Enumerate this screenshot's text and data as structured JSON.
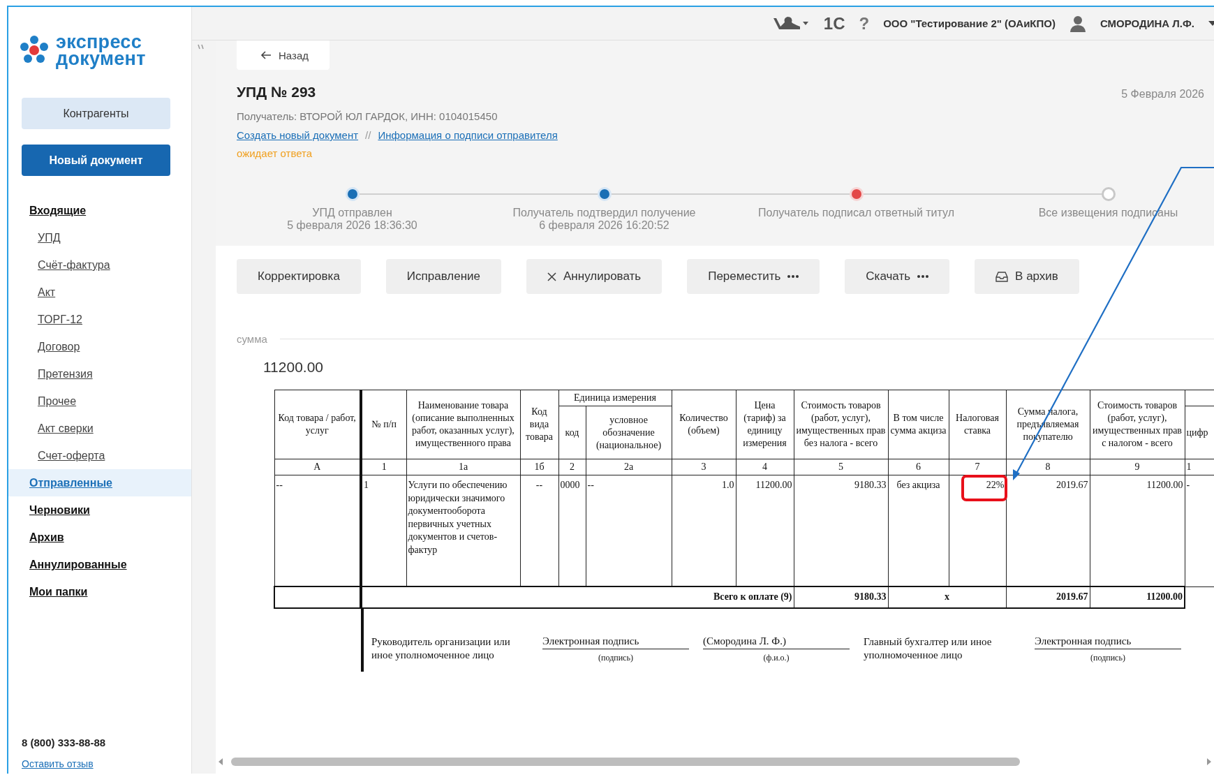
{
  "sidebar": {
    "logo": {
      "line1": "экспресс",
      "line2": "документ"
    },
    "contractors_button": "Контрагенты",
    "new_document_button": "Новый документ",
    "nav": [
      {
        "label": "Входящие",
        "selected": false,
        "children": [
          {
            "label": "УПД",
            "selected": false
          },
          {
            "label": "Счёт-фактура",
            "selected": false
          },
          {
            "label": "Акт",
            "selected": false
          },
          {
            "label": "ТОРГ-12",
            "selected": false
          },
          {
            "label": "Договор",
            "selected": false
          },
          {
            "label": "Претензия",
            "selected": false
          },
          {
            "label": "Прочее",
            "selected": false
          },
          {
            "label": "Акт сверки",
            "selected": false
          },
          {
            "label": "Счет-оферта",
            "selected": false
          }
        ]
      },
      {
        "label": "Отправленные",
        "selected": true
      },
      {
        "label": "Черновики",
        "selected": false
      },
      {
        "label": "Архив",
        "selected": false
      },
      {
        "label": "Аннулированные",
        "selected": false
      },
      {
        "label": "Мои папки",
        "selected": false
      }
    ],
    "phone": "8 (800) 333-88-88",
    "feedback_link": "Оставить отзыв"
  },
  "top_bar": {
    "logo_1c": "1С",
    "help": "?",
    "organization": "ООО \"Тестирование 2\" (ОАиКПО)",
    "user": "СМОРОДИНА Л.Ф."
  },
  "back_button": "Назад",
  "document": {
    "title": "УПД № 293",
    "date": "5 Февраля 2026",
    "recipient": "Получатель: ВТОРОЙ ЮЛ ГАРДОК, ИНН: 0104015450",
    "links": [
      "Создать новый документ",
      "Информация о подписи отправителя"
    ],
    "separator": "//",
    "status": "ожидает ответа"
  },
  "stepper": [
    {
      "label": "УПД отправлен",
      "date": "5 февраля 2026 18:36:30",
      "kind": "done"
    },
    {
      "label": "Получатель подтвердил получение",
      "date": "6 февраля 2026 16:20:52",
      "kind": "done"
    },
    {
      "label": "Получатель подписал ответный титул",
      "kind": "error"
    },
    {
      "label": "Все извещения подписаны",
      "kind": "pending"
    }
  ],
  "actions": [
    {
      "label": "Корректировка",
      "kind": "plain"
    },
    {
      "label": "Исправление",
      "kind": "plain"
    },
    {
      "label": "Аннулировать",
      "kind": "cancel"
    },
    {
      "label": "Переместить",
      "kind": "more"
    },
    {
      "label": "Скачать",
      "kind": "more"
    },
    {
      "label": "В архив",
      "kind": "archive"
    }
  ],
  "sum": {
    "label": "сумма",
    "value": "11200.00"
  },
  "invoice_table": {
    "unit_group": "Единица измерения",
    "columns": [
      {
        "number": "А",
        "header": "Код товара / работ, услуг"
      },
      {
        "number": "1",
        "header": "№ п/п"
      },
      {
        "number": "1а",
        "header": "Наименование товара (описание выполненных работ, оказанных услуг), имущественного права"
      },
      {
        "number": "1б",
        "header": "Код вида товара"
      },
      {
        "number": "2",
        "header": "код",
        "kind": "unit"
      },
      {
        "number": "2а",
        "header": "условное обозначение (национальное)",
        "kind": "unit"
      },
      {
        "number": "3",
        "header": "Количество (объем)"
      },
      {
        "number": "4",
        "header": "Цена (тариф) за единицу измерения"
      },
      {
        "number": "5",
        "header": "Стоимость товаров (работ, услуг), имущественных прав без налога - всего"
      },
      {
        "number": "6",
        "header": "В том числе сумма акциза"
      },
      {
        "number": "7",
        "header": "Налоговая ставка"
      },
      {
        "number": "8",
        "header": "Сумма налога, предъявляемая покупателю"
      },
      {
        "number": "9",
        "header": "Стоимость товаров (работ, услуг), имущественных прав с налогом - всего"
      },
      {
        "number": "1",
        "header": "цифр",
        "kind": "cut"
      }
    ],
    "rows": [
      {
        "cells": [
          "--",
          "1",
          "Услуги по обеспечению юридически значимого документооборота первичных учетных документов и счетов-фактур",
          "--",
          "0000",
          "--",
          "1.0",
          "11200.00",
          "9180.33",
          "без акциза",
          "22%",
          "2019.67",
          "11200.00",
          "-"
        ]
      }
    ],
    "totals": {
      "label": "Всего к оплате (9)",
      "without_tax": "9180.33",
      "excise": "x",
      "tax": "2019.67",
      "with_tax": "11200.00"
    }
  },
  "signatures": [
    {
      "role": "Руководитель организации или иное уполномоченное лицо",
      "sign": "Электронная подпись",
      "sign_caption": "(подпись)",
      "name": "(Смородина Л. Ф.)",
      "name_caption": "(ф.и.о.)"
    },
    {
      "role": "Главный бухгалтер или иное уполномоченное лицо",
      "sign": "Электронная подпись",
      "sign_caption": "(подпись)"
    }
  ]
}
